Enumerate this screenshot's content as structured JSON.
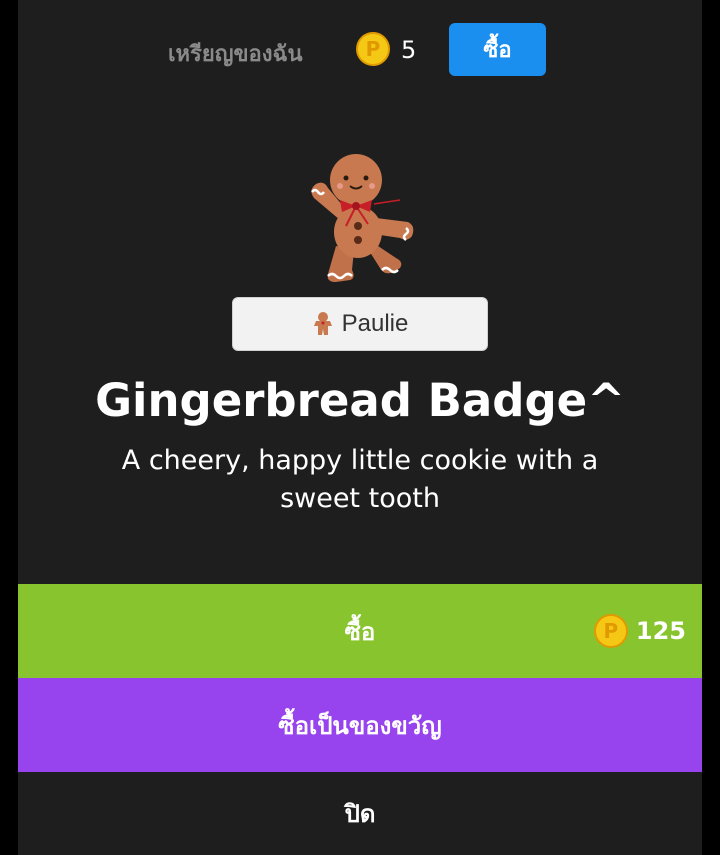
{
  "coins": {
    "label": "เหรียญของฉัน",
    "icon": "coin-icon",
    "coin_symbol": "P",
    "count": "5",
    "buy_label": "ซื้อ",
    "buy_color": "#1b8ff0",
    "coin_color": "#f6c816"
  },
  "item": {
    "image": "gingerbread-man-icon",
    "owner_icon": "gingerbread-small-icon",
    "owner_name": "Paulie",
    "title": "Gingerbread Badge^",
    "description": "A cheery, happy little cookie with a sweet tooth"
  },
  "actions": {
    "buy_label": "ซื้อ",
    "buy_color": "#88c42e",
    "price": "125",
    "gift_label": "ซื้อเป็นของขวัญ",
    "gift_color": "#9743ee",
    "close_label": "ปิด"
  }
}
